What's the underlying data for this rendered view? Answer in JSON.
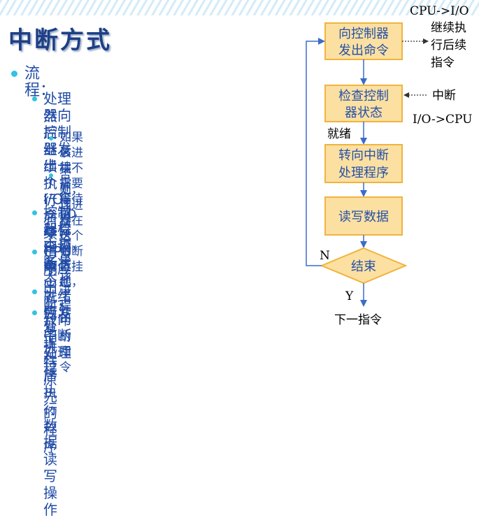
{
  "title": "中断方式",
  "section": "流程：",
  "items": [
    {
      "line1": "处理器向控制器发出一个I/O命令，",
      "line2": "然后继续执行后续指令"
    },
    {
      "line1": "如果该进程不需要等待I/O完成，",
      "line2": "后续指令可以仍是该进程中的指令"
    },
    {
      "line1": "否则，该进程在这个中断上挂起，",
      "line2": "处理器执行其他工作"
    },
    {
      "line1": "控制器检查设备状态，就绪后发",
      "line2": "起中断"
    },
    {
      "line1": "CPU响应中断，转向中断处理程",
      "line2": "序"
    },
    {
      "line1": "中断处理程序执行数据读写操作"
    },
    {
      "line1": "恢复执行原先的程序"
    }
  ],
  "flow": {
    "top_label": "CPU->I/O",
    "boxes": [
      {
        "line1": "向控制器",
        "line2": "发出命令"
      },
      {
        "line1": "检查控制",
        "line2": "器状态"
      },
      {
        "line1": "转向中断",
        "line2": "处理程序"
      },
      {
        "line1": "读写数据"
      }
    ],
    "diamond": "结束",
    "continue_label": {
      "line1": "继续执",
      "line2": "行后续",
      "line3": "指令"
    },
    "interrupt_label": "中断",
    "io_cpu_label": "I/O->CPU",
    "ready_label": "就绪",
    "no_label": "N",
    "yes_label": "Y",
    "next_label": "下一指令"
  },
  "colors": {
    "title": "#1d3f86",
    "text": "#1f4aa6",
    "bullet": "#33c3e0",
    "box_fill": "#fbe0a2",
    "box_border": "#f0b43c",
    "arrow": "#3a6cc8"
  }
}
